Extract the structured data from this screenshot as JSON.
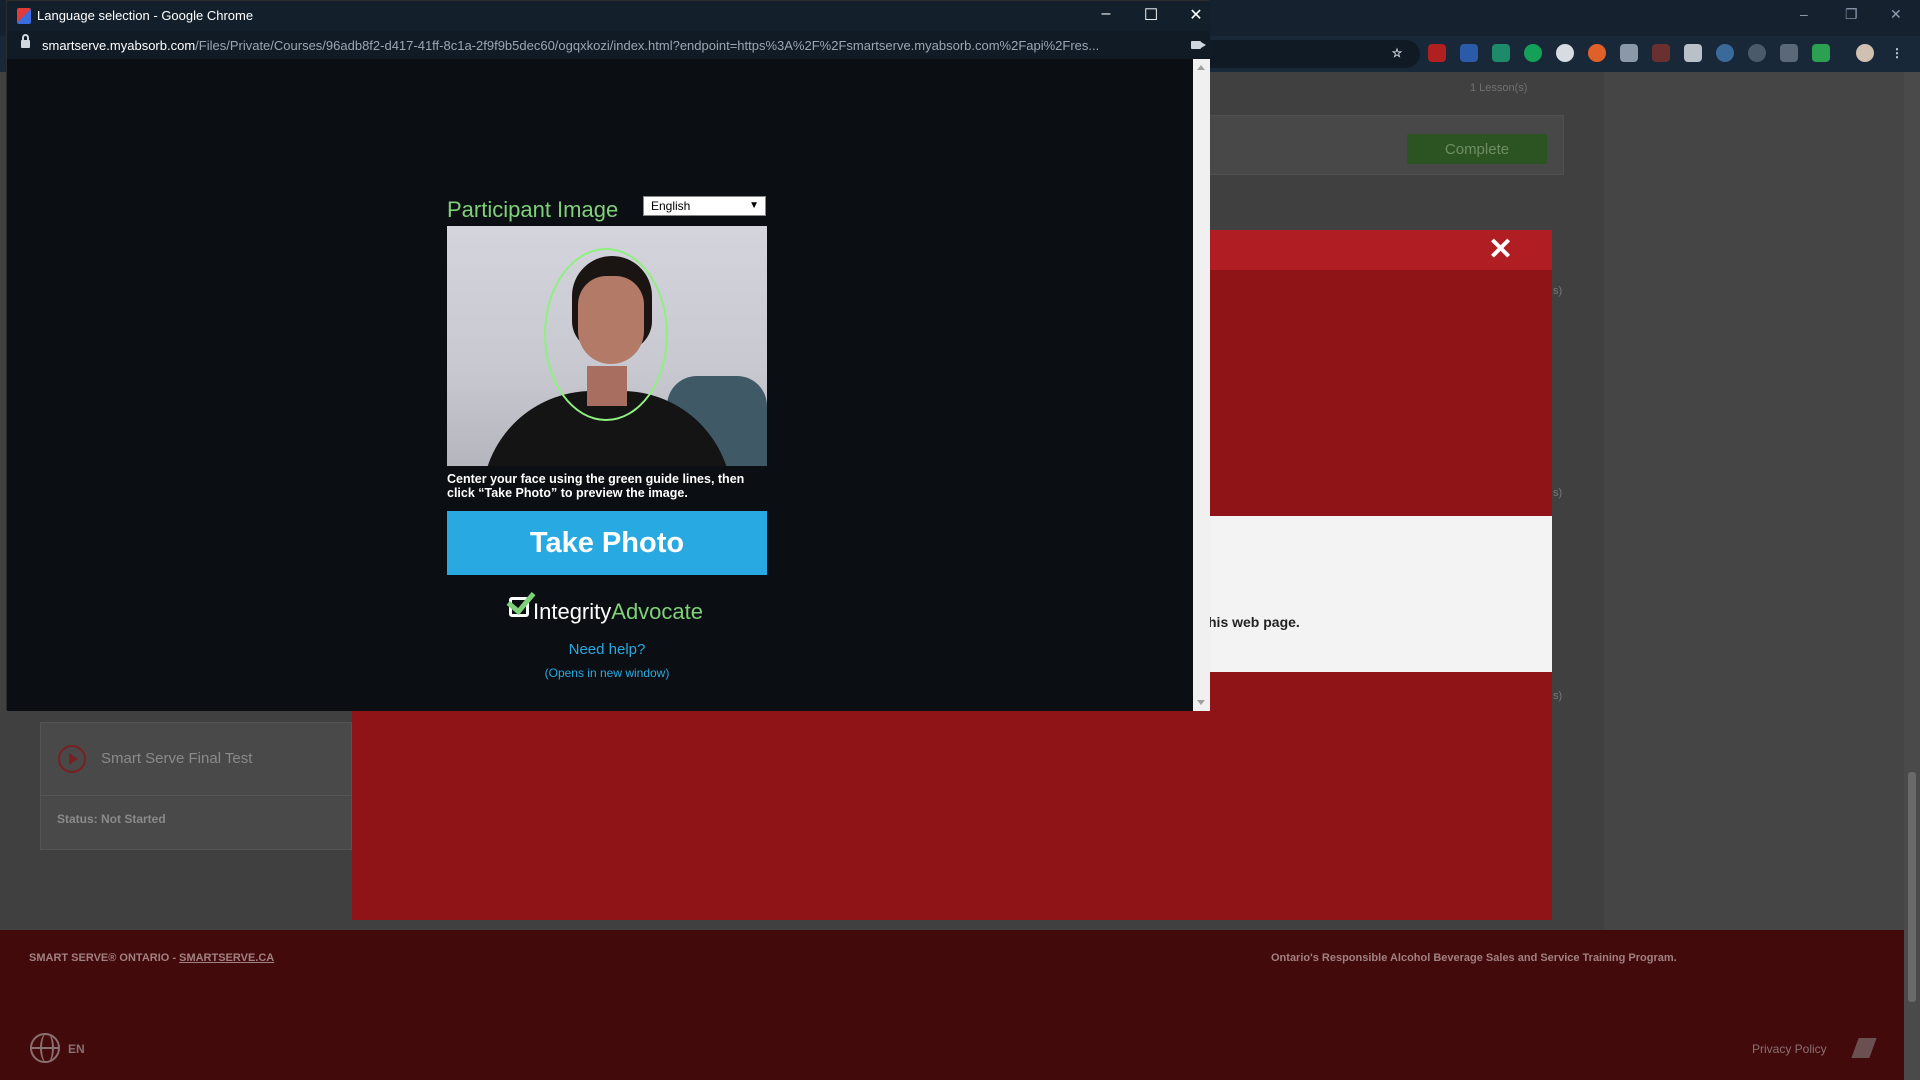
{
  "background": {
    "lessons_count": "1 Lesson(s)",
    "complete_label": "Complete",
    "close_glyph": "✕",
    "partial_text": "his web page.",
    "final_test_title": "Smart Serve Final Test",
    "final_test_status": "Status: Not Started",
    "side_marker": "s)",
    "footer_left_prefix": "SMART SERVE® ONTARIO - ",
    "footer_left_link": "SMARTSERVE.CA",
    "footer_right": "Ontario's Responsible Alcohol Beverage Sales and Service Training Program.",
    "language_code": "EN",
    "privacy_label": "Privacy Policy",
    "window_controls": [
      "–",
      "❐",
      "✕"
    ]
  },
  "popup": {
    "window_title": "Language selection - Google Chrome",
    "url_host": "smartserve.myabsorb.com",
    "url_path": "/Files/Private/Courses/96adb8f2-d417-41ff-8c1a-2f9f9b5dec60/ogqxkozi/index.html?endpoint=https%3A%2F%2Fsmartserve.myabsorb.com%2Fapi%2Fres...",
    "controls": [
      "–",
      "☐",
      "✕"
    ]
  },
  "modal": {
    "participant_label": "Participant Image",
    "language_selected": "English",
    "select_arrow": "▼",
    "instructions": "Center your face using the green guide lines, then click “Take Photo” to preview the image.",
    "take_photo_label": "Take Photo",
    "logo_part_a": "Integrity",
    "logo_part_b": "Advocate",
    "need_help": "Need help?",
    "opens_new": "(Opens in new window)"
  },
  "colors": {
    "accent_green": "#7fd07a",
    "accent_blue": "#29a9e1",
    "brand_red": "#b01d22",
    "complete_green": "#2c5322"
  }
}
